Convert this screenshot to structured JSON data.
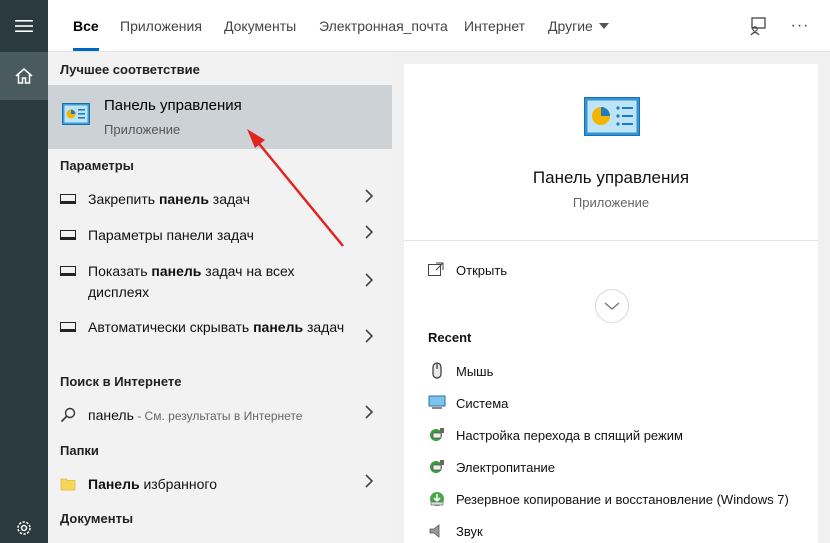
{
  "tabs": [
    {
      "label": "Все",
      "active": true
    },
    {
      "label": "Приложения"
    },
    {
      "label": "Документы"
    },
    {
      "label": "Электронная_почта"
    },
    {
      "label": "Интернет"
    },
    {
      "label": "Другие"
    }
  ],
  "icons": {
    "menu": "hamburger-icon",
    "home": "home-icon",
    "settings": "gear-icon",
    "feedback": "feedback-icon",
    "more": "more-icon"
  },
  "more_glyph": "···",
  "results": {
    "best_match_header": "Лучшее соответствие",
    "best_match": {
      "title": "Панель управления",
      "subtitle": "Приложение"
    },
    "settings_header": "Параметры",
    "settings_items": [
      {
        "pre": "Закрепить ",
        "bold": "панель",
        "post": " задач"
      },
      {
        "pre": "Параметры панели задач",
        "bold": "",
        "post": ""
      },
      {
        "pre": "Показать ",
        "bold": "панель",
        "post": " задач на всех дисплеях"
      },
      {
        "pre": "Автоматически скрывать ",
        "bold": "панель",
        "post": " задач"
      }
    ],
    "web_header": "Поиск в Интернете",
    "web_item": {
      "query": "панель",
      "hint": " - См. результаты в Интернете"
    },
    "folders_header": "Папки",
    "folder_item": {
      "bold": "Панель",
      "post": " избранного"
    },
    "docs_header": "Документы"
  },
  "preview": {
    "title": "Панель управления",
    "subtitle": "Приложение",
    "open_label": "Открыть",
    "recent_header": "Recent",
    "recent": [
      {
        "label": "Мышь",
        "icon": "mouse-icon"
      },
      {
        "label": "Система",
        "icon": "monitor-icon"
      },
      {
        "label": "Настройка перехода в спящий режим",
        "icon": "power-options-icon"
      },
      {
        "label": "Электропитание",
        "icon": "power-options-icon"
      },
      {
        "label": "Резервное копирование и восстановление (Windows 7)",
        "icon": "backup-icon"
      },
      {
        "label": "Звук",
        "icon": "speaker-icon"
      }
    ]
  },
  "colors": {
    "accent": "#0067c0",
    "rail": "#2b3a3f",
    "selected": "#cdd2d6",
    "annotation": "#e32222"
  }
}
